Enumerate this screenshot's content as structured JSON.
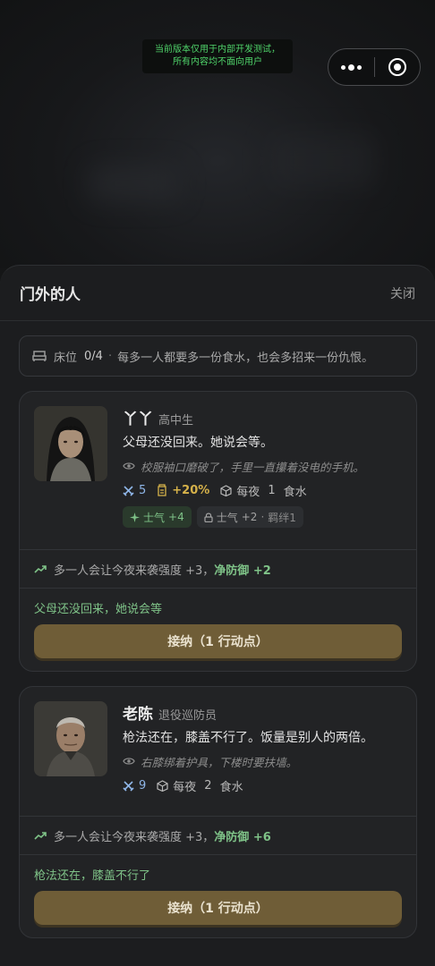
{
  "dev_banner": {
    "line1": "当前版本仅用于内部开发测试，",
    "line2": "所有内容均不面向用户"
  },
  "sheet": {
    "title": "门外的人",
    "close_label": "关闭"
  },
  "bed": {
    "label": "床位",
    "count": "0/4",
    "separator": "·",
    "text": "每多一人都要多一份食水，也会多招来一份仇恨。"
  },
  "candidates": [
    {
      "name": "丫丫",
      "role": "高中生",
      "quote": "父母还没回来。她说会等。",
      "observation": "校服袖口磨破了，手里一直攥着没电的手机。",
      "fight": "5",
      "bonus": "+20%",
      "food_prefix": "每夜",
      "food_amount": "1",
      "food_unit": "食水",
      "tags": [
        {
          "label": "士气",
          "value": "+4"
        },
        {
          "label": "士气",
          "value": "+2",
          "extra": "羁绊1"
        }
      ],
      "impact_text": "多一人会让今夜来袭强度 +3，",
      "impact_defense": "净防御 +2",
      "hint": "父母还没回来，她说会等",
      "accept_label": "接纳（1 行动点）"
    },
    {
      "name": "老陈",
      "role": "退役巡防员",
      "quote": "枪法还在，膝盖不行了。饭量是别人的两倍。",
      "observation": "右膝绑着护具，下楼时要扶墙。",
      "fight": "9",
      "food_prefix": "每夜",
      "food_amount": "2",
      "food_unit": "食水",
      "impact_text": "多一人会让今夜来袭强度 +3，",
      "impact_defense": "净防御 +6",
      "hint": "枪法还在，膝盖不行了",
      "accept_label": "接纳（1 行动点）"
    }
  ],
  "colors": {
    "accent_green": "#7fc388",
    "accent_gold": "#d6b24a",
    "accept_bg": "#6f5d37"
  }
}
